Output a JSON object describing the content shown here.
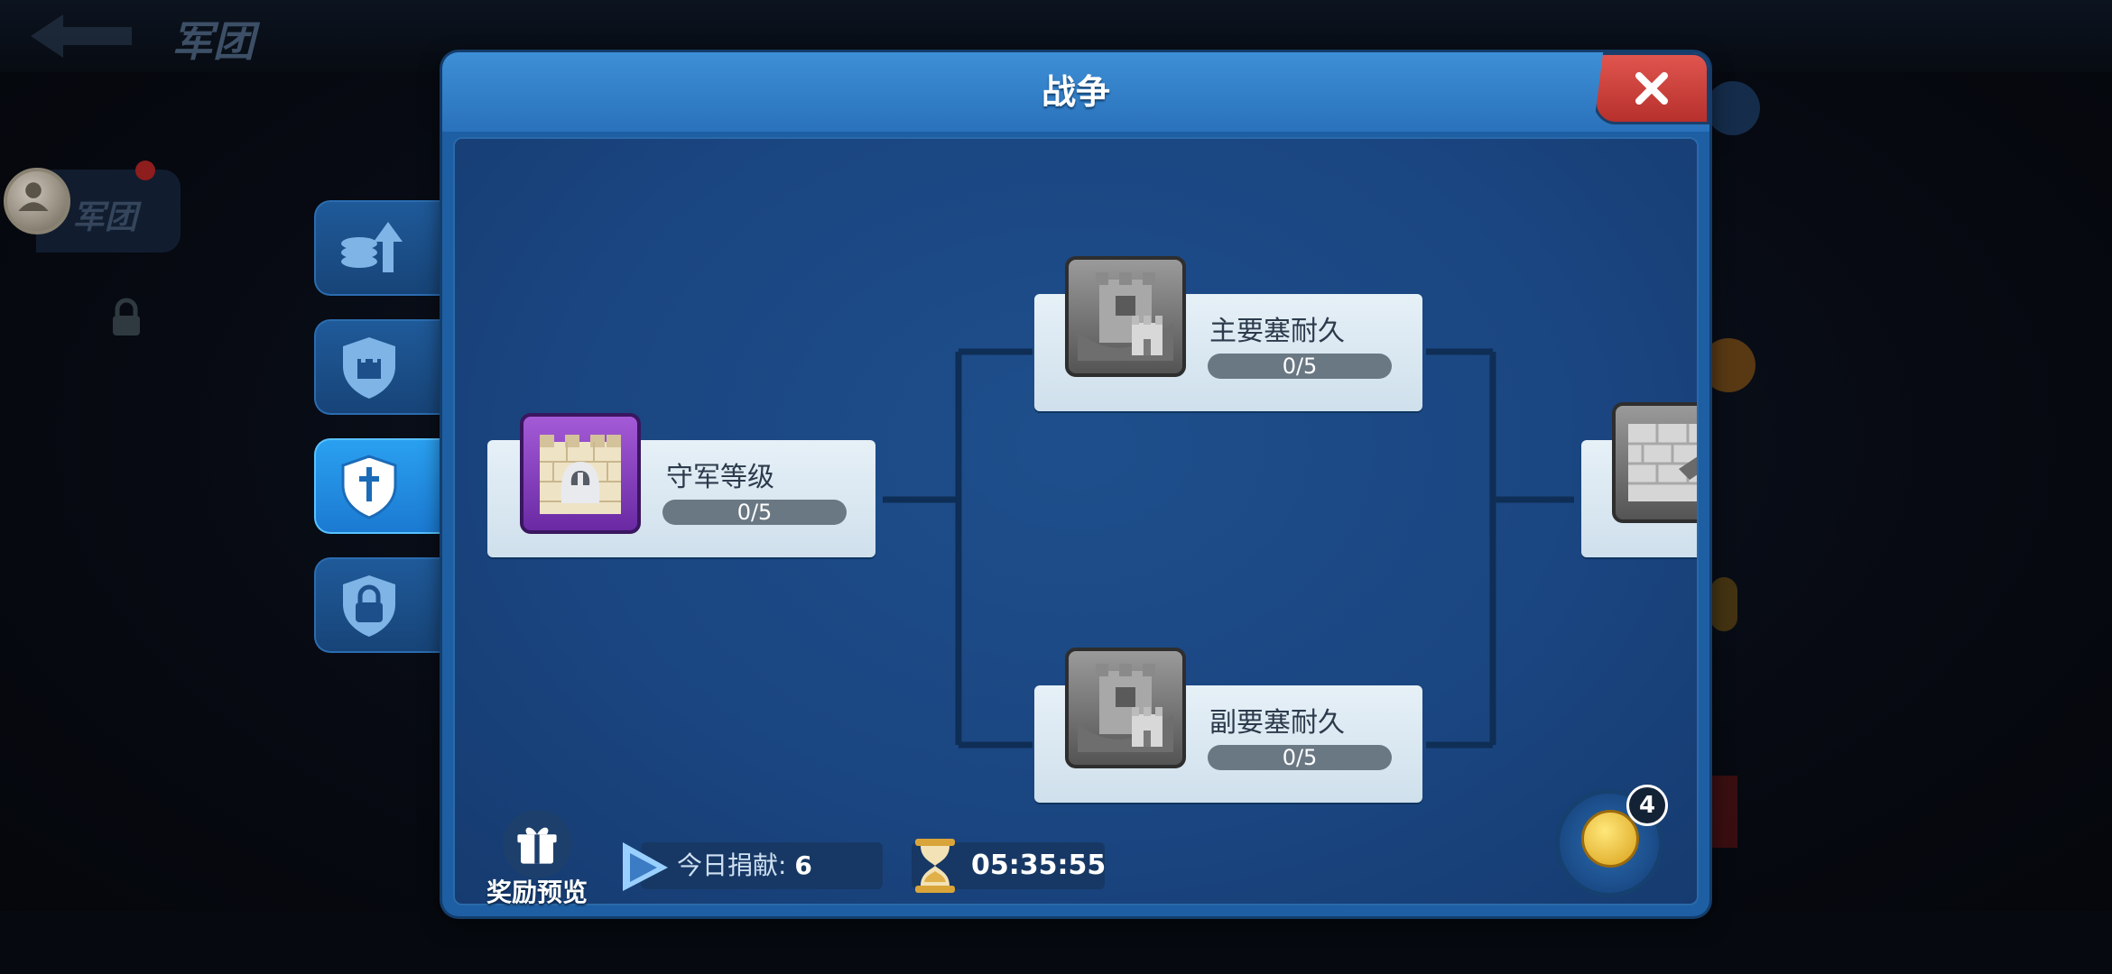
{
  "background": {
    "title": "军团",
    "avatar_label": "军团"
  },
  "dialog": {
    "title": "战争"
  },
  "nodes": [
    {
      "label": "守军等级",
      "progress": "0/5",
      "icon": "castle-knight-icon",
      "active": true
    },
    {
      "label": "主要塞耐久",
      "progress": "0/5",
      "icon": "fortress-tower-icon",
      "active": false
    },
    {
      "label": "副要塞耐久",
      "progress": "0/5",
      "icon": "fortress-tower-icon",
      "active": false
    },
    {
      "label": "",
      "progress": "",
      "icon": "wall-hammer-icon",
      "active": false
    }
  ],
  "footer": {
    "reward_label": "奖励预览",
    "donate_label": "今日捐献:",
    "donate_value": "6",
    "timer": "05:35:55"
  },
  "coin_badge": "4",
  "colors": {
    "dialog_bg": "#1e5ea3",
    "header_bg": "#3d8fd6",
    "close_red": "#d9453f",
    "node_card": "#dde9f2",
    "purple_icon": "#8a44c0",
    "active_tab": "#2aa0f0"
  }
}
